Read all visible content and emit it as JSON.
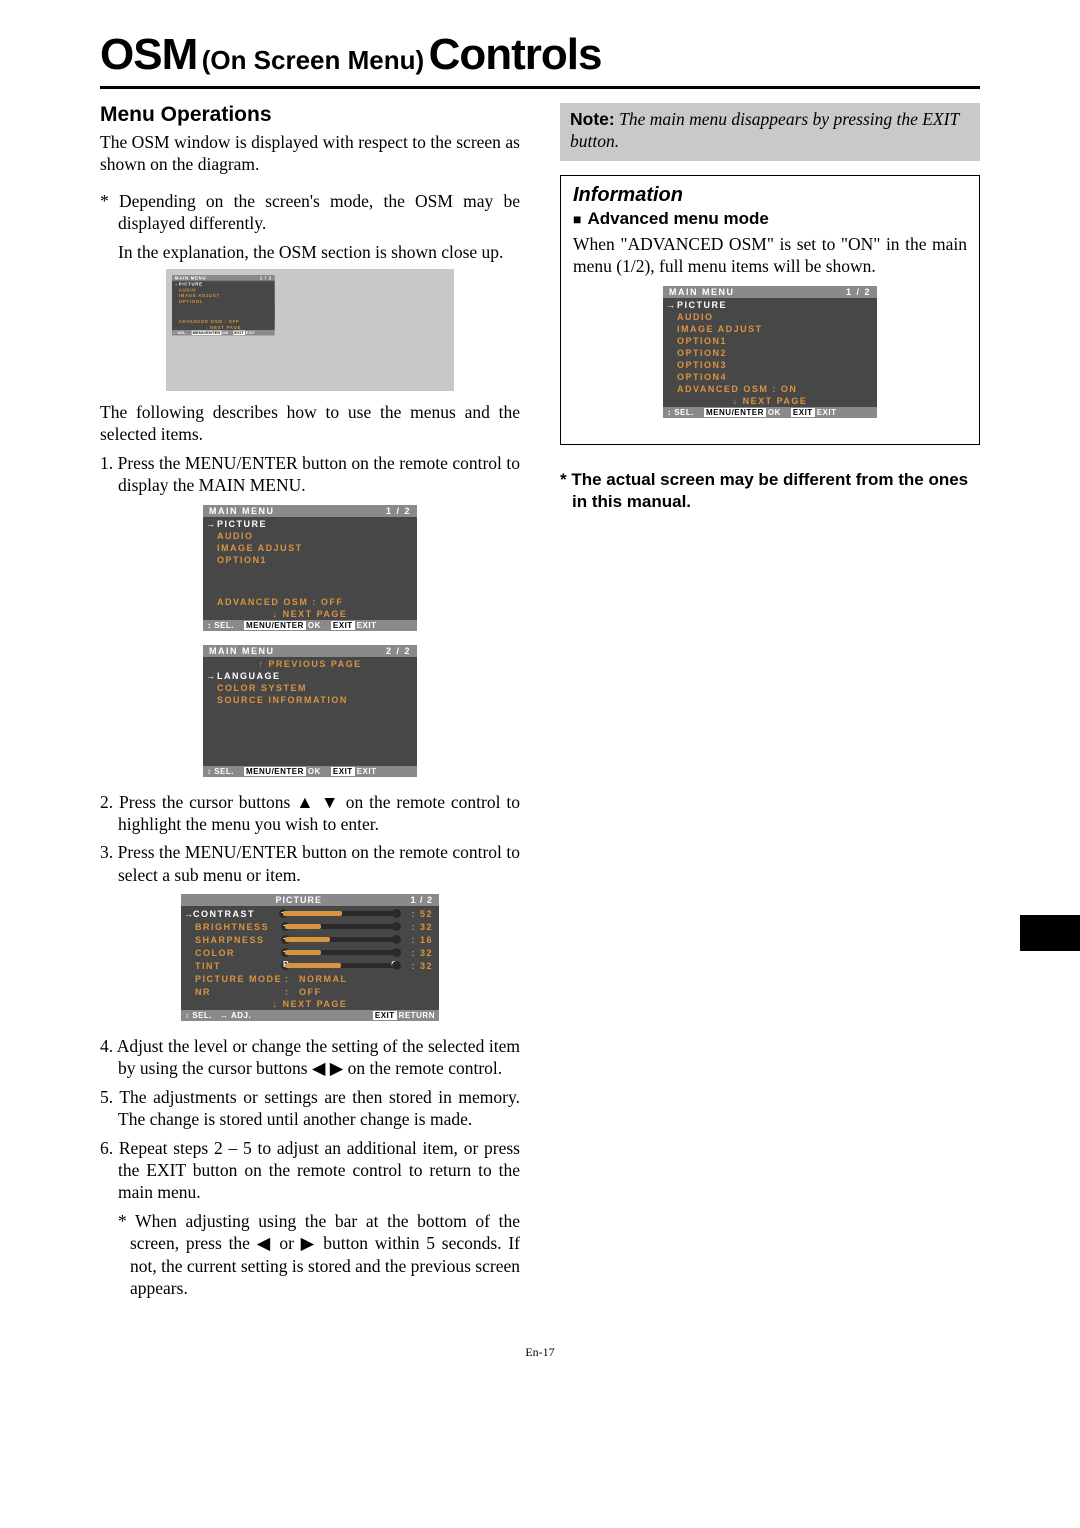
{
  "pageNumberLabel": "En-17",
  "title": {
    "osm": "OSM",
    "paren": "(On Screen Menu)",
    "controls": "Controls"
  },
  "left": {
    "heading": "Menu Operations",
    "intro": "The OSM window is displayed with respect to the screen as shown on the diagram.",
    "note1": "* Depending on the screen's mode, the OSM may be displayed differently.",
    "note1b": "In the explanation, the OSM section is shown close up.",
    "after_small": "The following describes how to use the menus and the selected items.",
    "step1": "1. Press the MENU/ENTER button on the remote control to display the MAIN MENU.",
    "step2": "2. Press the cursor buttons ▲ ▼ on the remote control to highlight the menu you wish to enter.",
    "step3": "3. Press the MENU/ENTER button on the remote control to select a sub menu or item.",
    "step4": "4. Adjust the level or change the setting of the selected item by using the cursor buttons ◀ ▶ on the remote control.",
    "step5": "5. The adjustments or settings are then stored in memory. The change is stored until another change is made.",
    "step6": "6. Repeat steps 2 – 5 to adjust an additional item, or press the EXIT button on the remote control to return to the main menu.",
    "step6sub": "* When adjusting using the bar at the bottom of the screen, press the ◀ or ▶ button within 5 seconds. If not, the current setting is stored and the previous screen appears."
  },
  "right": {
    "noteLabel": "Note:",
    "noteText": " The main menu disappears by pressing the EXIT button.",
    "infoHeading": "Information",
    "infoSub": "Advanced menu mode",
    "infoBody": "When \"ADVANCED OSM\" is set to \"ON\" in the main menu (1/2), full menu items will be shown.",
    "actualNote": "* The actual screen may be different from the ones in this manual."
  },
  "osm": {
    "header": "MAIN MENU",
    "p12": "1 / 2",
    "p22": "2 / 2",
    "items1": [
      "PICTURE",
      "AUDIO",
      "IMAGE ADJUST",
      "OPTION1"
    ],
    "advOff": "ADVANCED OSM   :   OFF",
    "advOn": "ADVANCED OSM   :   ON",
    "nextPage": "↓  NEXT PAGE",
    "prevPage": "↑  PREVIOUS PAGE",
    "items2": [
      "LANGUAGE",
      "COLOR SYSTEM",
      "SOURCE INFORMATION"
    ],
    "itemsFull": [
      "PICTURE",
      "AUDIO",
      "IMAGE ADJUST",
      "OPTION1",
      "OPTION2",
      "OPTION3",
      "OPTION4"
    ],
    "footer": {
      "sel": "SEL.",
      "ok": "OK",
      "exit": "EXIT",
      "menuEnter": "MENU/ENTER",
      "exitBtn": "EXIT",
      "adj": "ADJ.",
      "return": "RETURN",
      "updown": "↕",
      "lr": "↔"
    }
  },
  "picture": {
    "header": "PICTURE",
    "page": "1 / 2",
    "rows": [
      {
        "label": "CONTRAST",
        "val": "52",
        "fill": 52,
        "type": "bar",
        "sel": true
      },
      {
        "label": "BRIGHTNESS",
        "val": "32",
        "fill": 32,
        "type": "bar"
      },
      {
        "label": "SHARPNESS",
        "val": "16",
        "fill": 40,
        "type": "bar"
      },
      {
        "label": "COLOR",
        "val": "32",
        "fill": 32,
        "type": "bar"
      },
      {
        "label": "TINT",
        "val": "32",
        "fill": 50,
        "type": "bar",
        "rg": true
      },
      {
        "label": "PICTURE MODE",
        "txt": "NORMAL",
        "type": "txt"
      },
      {
        "label": "NR",
        "txt": "OFF",
        "type": "txt"
      }
    ],
    "next": "↓  NEXT PAGE"
  }
}
